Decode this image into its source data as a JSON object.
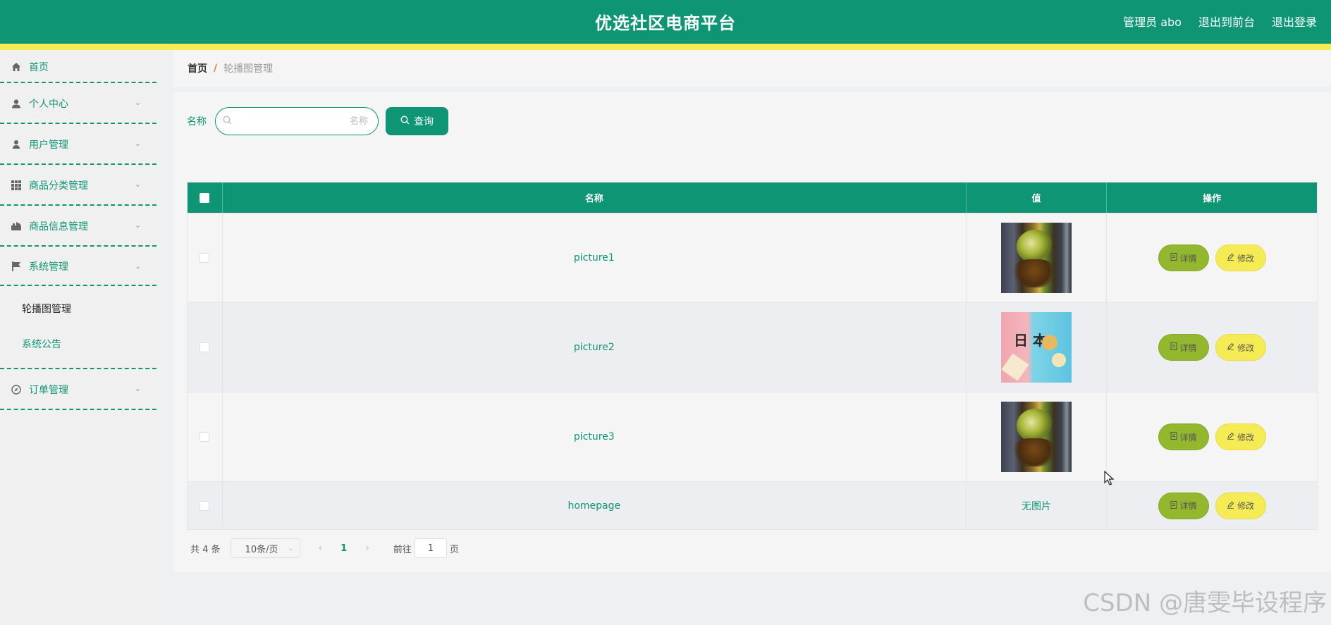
{
  "header": {
    "title": "优选社区电商平台",
    "admin": "管理员 abo",
    "to_front": "退出到前台",
    "logout": "退出登录",
    "brand_color": "#0e9574",
    "stripe_color": "#f5eb55"
  },
  "sidebar": {
    "items": [
      {
        "label": "首页",
        "icon": "home-icon"
      },
      {
        "label": "个人中心",
        "icon": "person-icon"
      },
      {
        "label": "用户管理",
        "icon": "user-icon"
      },
      {
        "label": "商品分类管理",
        "icon": "grid-icon"
      },
      {
        "label": "商品信息管理",
        "icon": "shop-icon"
      },
      {
        "label": "系统管理",
        "icon": "flag-icon",
        "expanded": true
      },
      {
        "label": "订单管理",
        "icon": "compass-icon"
      }
    ],
    "sub_items": [
      {
        "label": "轮播图管理",
        "active": true
      },
      {
        "label": "系统公告",
        "active": false
      }
    ]
  },
  "breadcrumb": {
    "home": "首页",
    "sep": "/",
    "current": "轮播图管理"
  },
  "search": {
    "label": "名称",
    "placeholder": "名称",
    "button": "查询"
  },
  "table": {
    "headers": [
      "名称",
      "值",
      "操作"
    ],
    "rows": [
      {
        "name": "picture1",
        "value_type": "image-food"
      },
      {
        "name": "picture2",
        "value_type": "image-japan"
      },
      {
        "name": "picture3",
        "value_type": "image-food"
      },
      {
        "name": "homepage",
        "value_text": "无图片"
      }
    ],
    "detail_label": "详情",
    "edit_label": "修改",
    "thumb_jp_text": "日 本"
  },
  "pager": {
    "total": "共 4 条",
    "page_size": "10条/页",
    "current_page": "1",
    "goto_prefix": "前往",
    "goto_value": "1",
    "goto_suffix": "页"
  },
  "watermark": "CSDN @唐雯毕设程序"
}
